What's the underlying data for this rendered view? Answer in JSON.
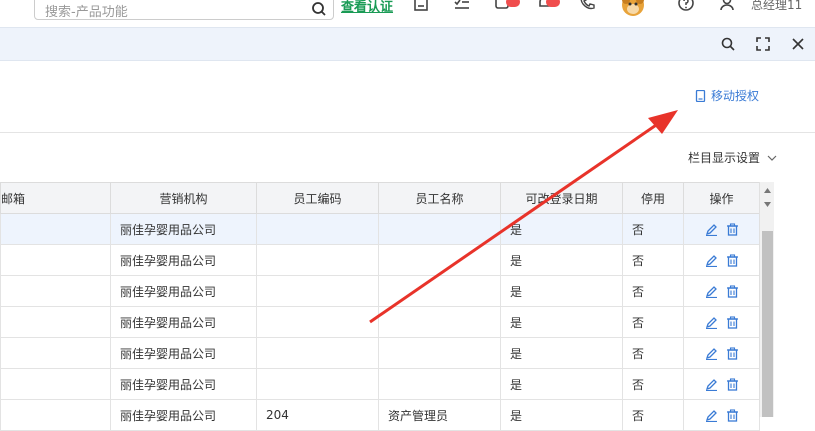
{
  "header": {
    "search_placeholder": "搜索-产品功能",
    "verify_link": "查看认证",
    "username": "总经理11"
  },
  "toolbar": {
    "mobile_auth_label": "移动授权"
  },
  "column_settings_label": "栏目显示设置",
  "table": {
    "columns": [
      "邮箱",
      "营销机构",
      "员工编码",
      "员工名称",
      "可改登录日期",
      "停用",
      "操作"
    ],
    "rows": [
      {
        "email": "",
        "org": "丽佳孕婴用品公司",
        "code": "",
        "name": "",
        "can_change": "是",
        "disabled": "否"
      },
      {
        "email": "",
        "org": "丽佳孕婴用品公司",
        "code": "",
        "name": "",
        "can_change": "是",
        "disabled": "否"
      },
      {
        "email": "",
        "org": "丽佳孕婴用品公司",
        "code": "",
        "name": "",
        "can_change": "是",
        "disabled": "否"
      },
      {
        "email": "",
        "org": "丽佳孕婴用品公司",
        "code": "",
        "name": "",
        "can_change": "是",
        "disabled": "否"
      },
      {
        "email": "",
        "org": "丽佳孕婴用品公司",
        "code": "",
        "name": "",
        "can_change": "是",
        "disabled": "否"
      },
      {
        "email": "",
        "org": "丽佳孕婴用品公司",
        "code": "",
        "name": "",
        "can_change": "是",
        "disabled": "否"
      },
      {
        "email": "",
        "org": "丽佳孕婴用品公司",
        "code": "204",
        "name": "资产管理员",
        "can_change": "是",
        "disabled": "否"
      }
    ]
  },
  "colors": {
    "accent": "#3a7bd5",
    "verify": "#1a9b55",
    "annotation_arrow": "#e8332a"
  }
}
